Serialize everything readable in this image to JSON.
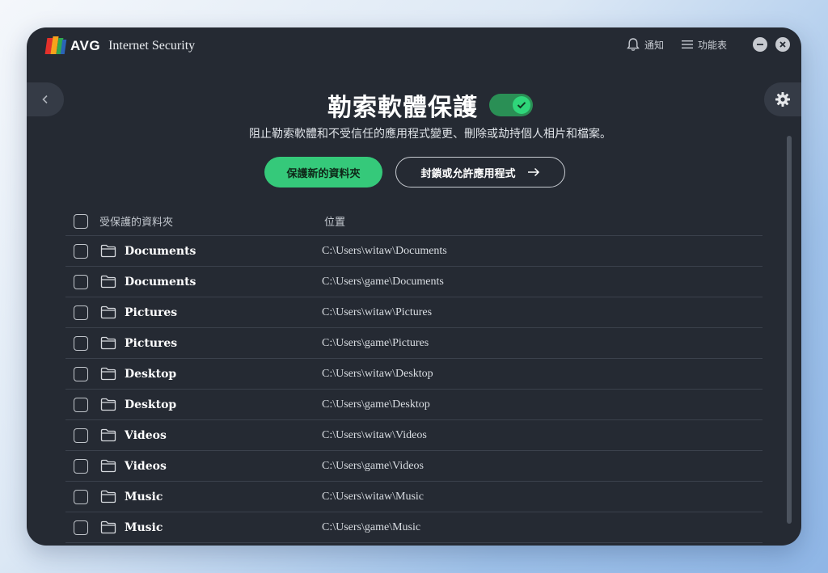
{
  "app": {
    "brand": "AVG",
    "product": "Internet Security"
  },
  "header": {
    "notifications_label": "通知",
    "menu_label": "功能表"
  },
  "page": {
    "title": "勒索軟體保護",
    "toggle_on": true,
    "description": "阻止勒索軟體和不受信任的應用程式變更、刪除或劫持個人相片和檔案。",
    "primary_button": "保護新的資料夾",
    "secondary_button": "封鎖或允許應用程式"
  },
  "table": {
    "col_name": "受保護的資料夾",
    "col_location": "位置",
    "rows": [
      {
        "name": "Documents",
        "location": "C:\\Users\\witaw\\Documents"
      },
      {
        "name": "Documents",
        "location": "C:\\Users\\game\\Documents"
      },
      {
        "name": "Pictures",
        "location": "C:\\Users\\witaw\\Pictures"
      },
      {
        "name": "Pictures",
        "location": "C:\\Users\\game\\Pictures"
      },
      {
        "name": "Desktop",
        "location": "C:\\Users\\witaw\\Desktop"
      },
      {
        "name": "Desktop",
        "location": "C:\\Users\\game\\Desktop"
      },
      {
        "name": "Videos",
        "location": "C:\\Users\\witaw\\Videos"
      },
      {
        "name": "Videos",
        "location": "C:\\Users\\game\\Videos"
      },
      {
        "name": "Music",
        "location": "C:\\Users\\witaw\\Music"
      },
      {
        "name": "Music",
        "location": "C:\\Users\\game\\Music"
      }
    ]
  },
  "icons": {
    "logo": "avg-logo-icon",
    "bell": "bell-icon",
    "menu": "hamburger-menu-icon",
    "minimize": "minimize-icon",
    "close": "close-icon",
    "back": "chevron-left-icon",
    "settings": "gear-icon",
    "folder": "folder-icon",
    "arrow": "arrow-right-icon",
    "check": "check-icon"
  },
  "colors": {
    "window_bg": "#252a33",
    "accent_green": "#35c97a",
    "toggle_track": "#2a8f55"
  }
}
